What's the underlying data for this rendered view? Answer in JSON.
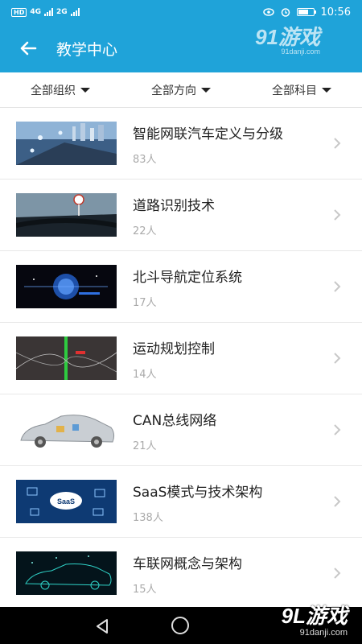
{
  "status_bar": {
    "sim": "HD",
    "net1": "4G",
    "net2": "2G",
    "time": "10:56"
  },
  "header": {
    "title": "教学中心",
    "back_icon": "arrow-left-icon"
  },
  "watermark": {
    "top_logo": "91游戏",
    "top_url": "91danji.com",
    "bottom_logo": "9L游戏",
    "bottom_url": "91danji.com"
  },
  "filters": [
    {
      "label": "全部组织"
    },
    {
      "label": "全部方向"
    },
    {
      "label": "全部科目"
    }
  ],
  "courses": [
    {
      "title": "智能网联汽车定义与分级",
      "count": "83人",
      "thumb_color": "#3c5f86"
    },
    {
      "title": "道路识别技术",
      "count": "22人",
      "thumb_color": "#2b3a46"
    },
    {
      "title": "北斗导航定位系统",
      "count": "17人",
      "thumb_color": "#06070f"
    },
    {
      "title": "运动规划控制",
      "count": "14人",
      "thumb_color": "#3a3535"
    },
    {
      "title": "CAN总线网络",
      "count": "21人",
      "thumb_color": "#d7d7d7"
    },
    {
      "title": "SaaS模式与技术架构",
      "count": "138人",
      "thumb_color": "#0e3a73"
    },
    {
      "title": "车联网概念与架构",
      "count": "15人",
      "thumb_color": "#04141b"
    }
  ],
  "navbar": {
    "back_icon": "triangle-back-icon",
    "home_icon": "circle-home-icon"
  }
}
